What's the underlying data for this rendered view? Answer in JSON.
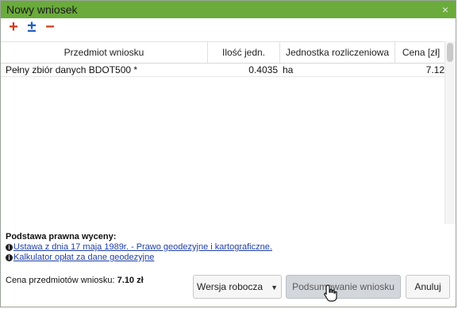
{
  "dialog": {
    "title": "Nowy wniosek",
    "close_symbol": "×"
  },
  "toolbar": {
    "add_symbol": "+",
    "toggle_symbol": "±",
    "remove_symbol": "−",
    "add_color": "#d0391b",
    "toggle_color": "#1f5fbf",
    "remove_color": "#d0391b"
  },
  "table": {
    "columns": [
      "Przedmiot wniosku",
      "Ilość jedn.",
      "Jednostka rozliczeniowa",
      "Cena [zł]"
    ],
    "rows": [
      [
        "Pełny zbiór danych BDOT500 *",
        "0.4035",
        "ha",
        "7.12"
      ]
    ]
  },
  "legal": {
    "heading": "Podstawa prawna wyceny:",
    "links": [
      "Ustawa z dnia 17 maja 1989r. - Prawo geodezyjne i kartograficzne.",
      "Kalkulator opłat za dane geodezyjne"
    ]
  },
  "footer": {
    "total_label": "Cena przedmiotów wniosku:",
    "total_value": "7.10 zł",
    "draft_button": "Wersja robocza",
    "summary_button": "Podsumowanie wniosku",
    "cancel_button": "Anuluj"
  },
  "colors": {
    "titlebar": "#6aab3c",
    "link": "#1f3fa6"
  }
}
